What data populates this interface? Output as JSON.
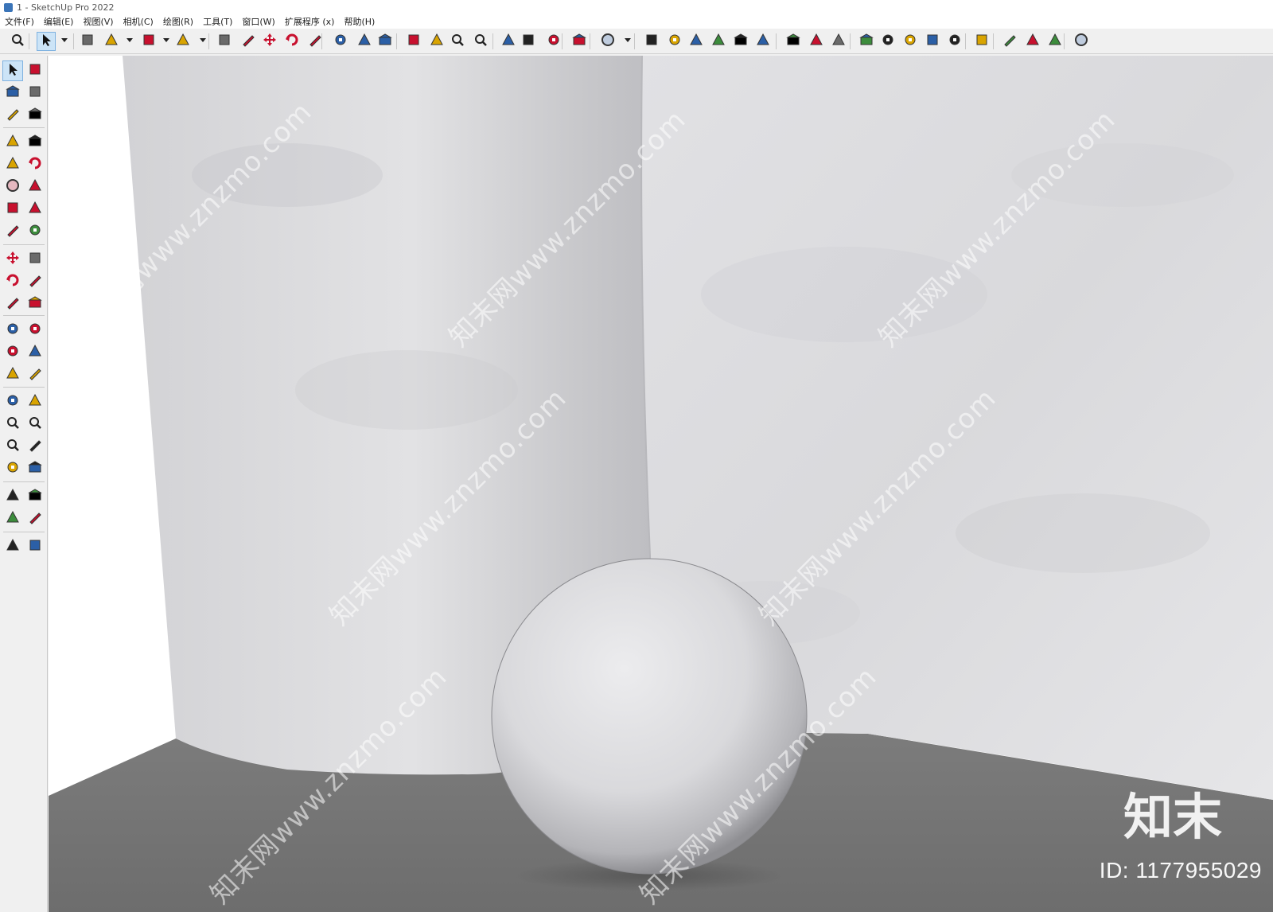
{
  "window": {
    "title": "1 - SketchUp Pro 2022"
  },
  "menu": [
    "文件(F)",
    "编辑(E)",
    "视图(V)",
    "相机(C)",
    "绘图(R)",
    "工具(T)",
    "窗口(W)",
    "扩展程序 (x)",
    "帮助(H)"
  ],
  "toolbar_icons": [
    "zoom-icon",
    "select-icon",
    "eraser-icon",
    "pencil-icon",
    "arc-icon",
    "rectangle-icon",
    "push-pull-icon",
    "follow-me-icon",
    "move-icon",
    "rotate-icon",
    "scale-icon",
    "tape-measure-icon",
    "text-icon",
    "paint-bucket-icon",
    "orbit-icon",
    "pan-icon",
    "zoom-tool-icon",
    "zoom-extents-icon",
    "warehouse-icon",
    "extension-warehouse-icon",
    "layout-icon",
    "style-builder-icon",
    "account-icon",
    "iso-view-icon",
    "top-view-icon",
    "front-view-icon",
    "right-view-icon",
    "back-view-icon",
    "left-view-icon",
    "section-plane-icon",
    "section-display-icon",
    "section-cut-icon",
    "add-location-icon",
    "sandbox-icon",
    "solid-tools-icon",
    "checker-icon",
    "cloud-icon",
    "settings-icon",
    "trimble-connect-icon",
    "info-icon",
    "cart-icon",
    "profile-icon"
  ],
  "left_tool_icons": [
    "select-icon",
    "orbit-icon",
    "paint-bucket-icon",
    "eraser-icon",
    "component-icon",
    "tag-icon",
    "pencil-icon",
    "freehand-icon",
    "rectangle-icon",
    "rotated-rectangle-icon",
    "circle-icon",
    "polygon-icon",
    "arc-icon",
    "two-point-arc-icon",
    "three-point-arc-icon",
    "pie-icon",
    "move-icon",
    "push-pull-icon",
    "rotate-icon",
    "follow-me-icon",
    "scale-icon",
    "offset-icon",
    "tape-measure-icon",
    "dimension-icon",
    "protractor-icon",
    "text-icon",
    "axes-icon",
    "3d-text-icon",
    "orbit-tool-icon",
    "pan-icon",
    "zoom-icon",
    "zoom-window-icon",
    "zoom-extents-icon",
    "previous-view-icon",
    "position-camera-icon",
    "look-around-icon",
    "walk-icon",
    "section-plane-icon",
    "sandbox-from-contours-icon",
    "sandbox-scratch-icon",
    "smoove-icon",
    "stamp-icon"
  ],
  "watermark": {
    "text": "知末网www.znzmo.com",
    "logo": "知末",
    "id": "ID: 1177955029"
  },
  "colors": {
    "wall": "#d9d9dc",
    "floor": "#7a7a7a",
    "sky": "#ffffff",
    "sphere": "#dcdcdc",
    "accent": "#cce4f7"
  }
}
